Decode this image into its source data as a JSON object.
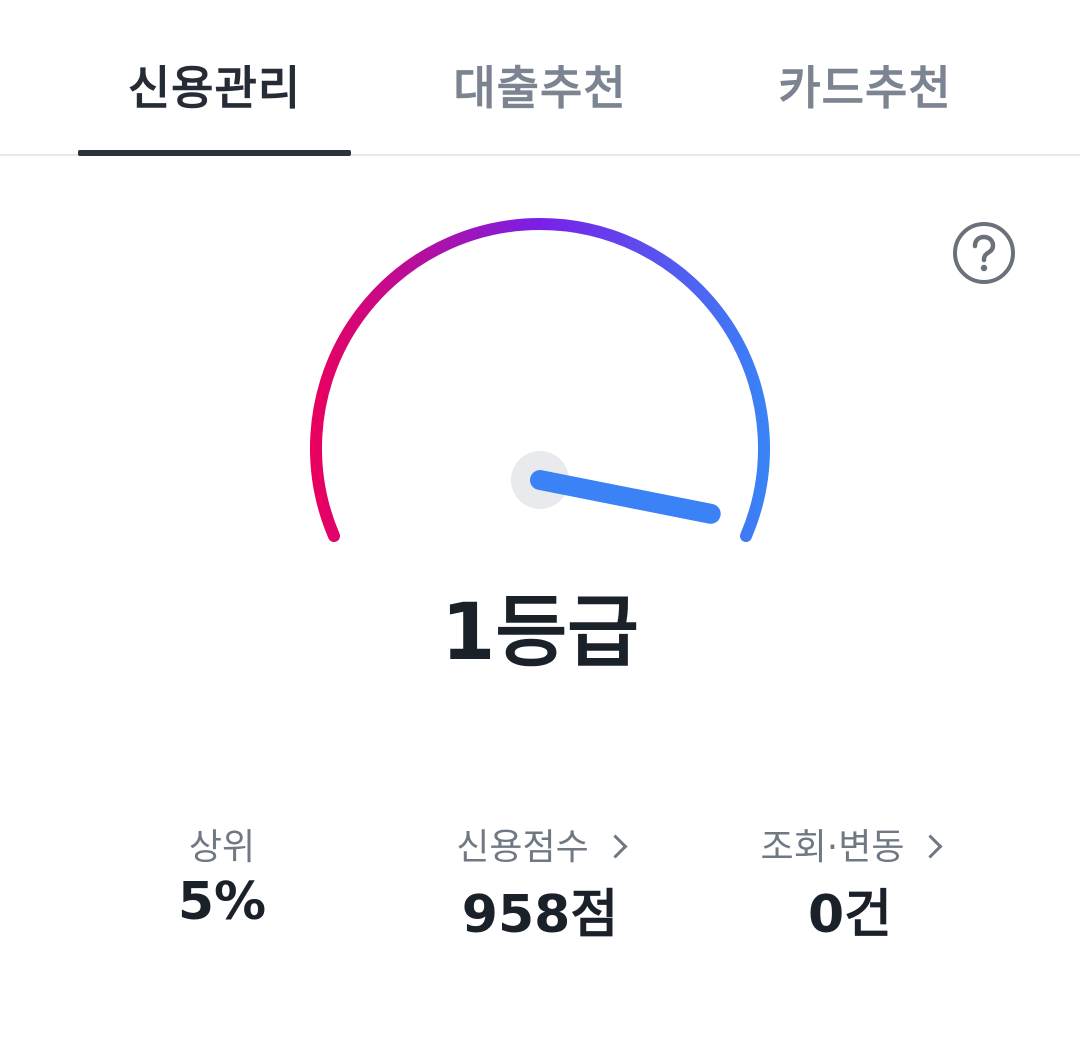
{
  "tabs": [
    {
      "label": "신용관리",
      "active": true
    },
    {
      "label": "대출추천",
      "active": false
    },
    {
      "label": "카드추천",
      "active": false
    }
  ],
  "gauge": {
    "grade_text": "1등급",
    "level": 0.96,
    "gradient_colors": [
      "#e8005f",
      "#7a1fe8",
      "#3a82f6"
    ],
    "needle_color": "#3a82f6"
  },
  "help_icon": "question-circle-icon",
  "stats": [
    {
      "label": "상위",
      "value": "5%",
      "has_chevron": false
    },
    {
      "label": "신용점수",
      "value": "958점",
      "has_chevron": true
    },
    {
      "label": "조회·변동",
      "value": "0건",
      "has_chevron": true
    }
  ]
}
